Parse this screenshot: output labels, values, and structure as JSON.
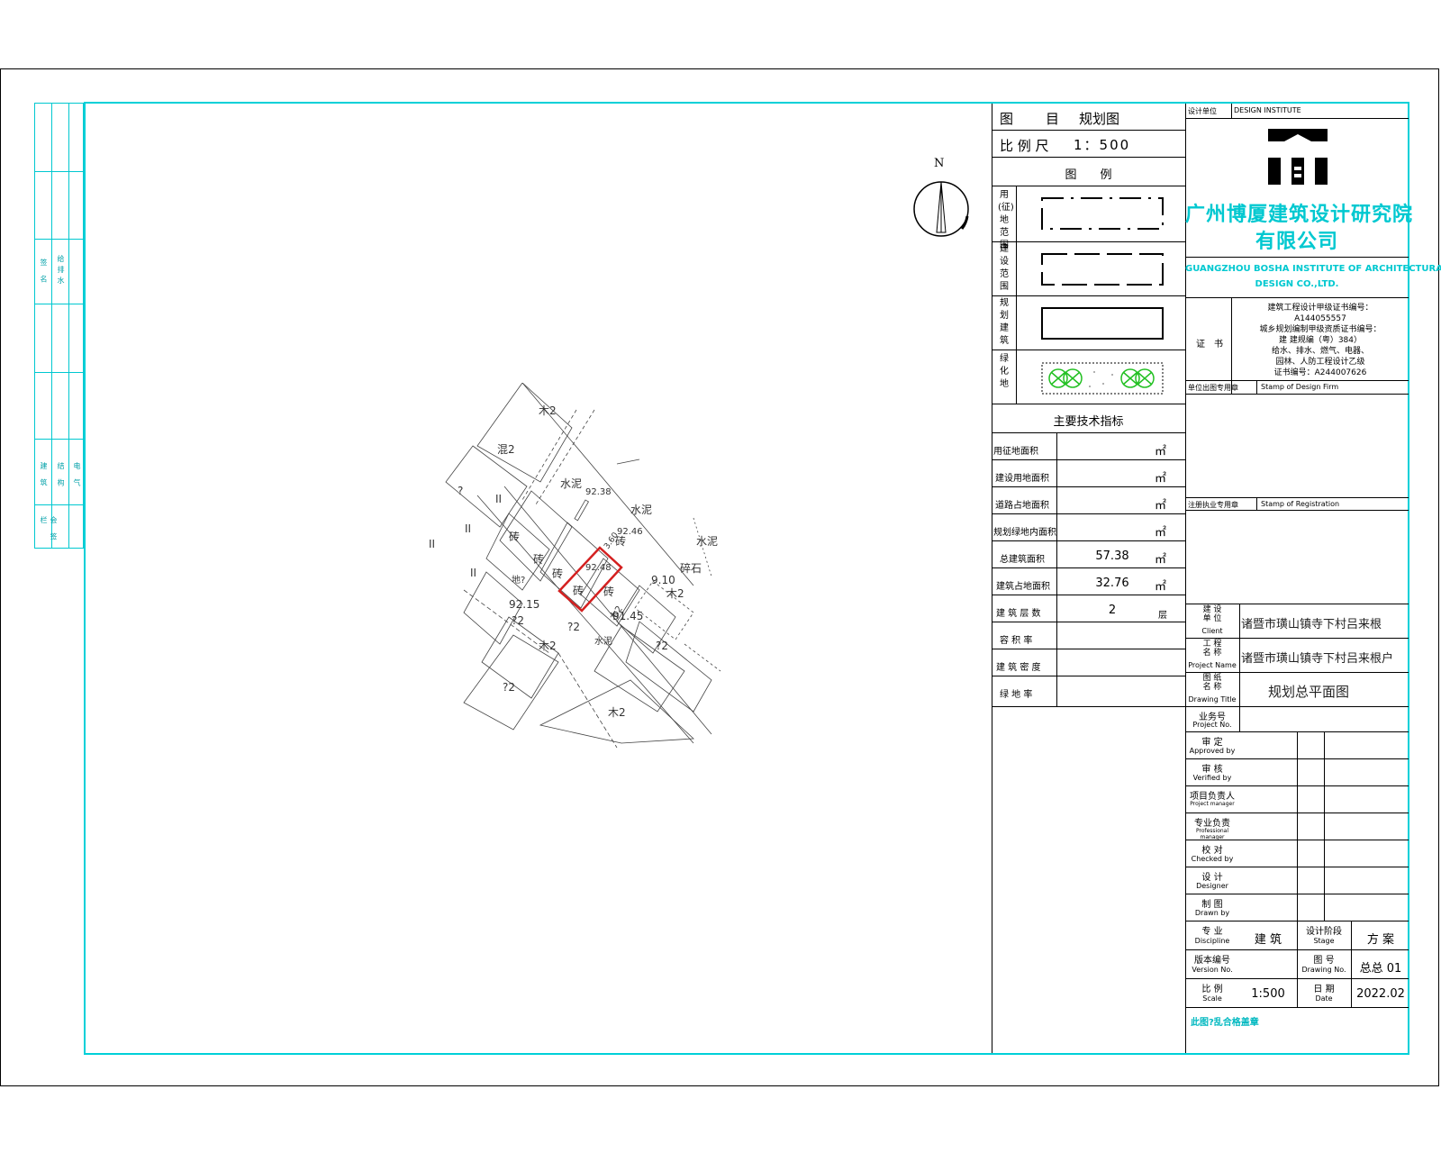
{
  "left_strip": {
    "labels": [
      "签 名",
      "给排水",
      "建 筑",
      "结 构",
      "电 气",
      "会 签 栏"
    ]
  },
  "north_arrow": {
    "letter": "N"
  },
  "site_plan": {
    "labels": [
      {
        "t": "木2"
      },
      {
        "t": "混2"
      },
      {
        "t": "水泥"
      },
      {
        "t": "92.38"
      },
      {
        "t": "水泥"
      },
      {
        "t": "92.46"
      },
      {
        "t": "砖"
      },
      {
        "t": "砖"
      },
      {
        "t": "砖"
      },
      {
        "t": "砖"
      },
      {
        "t": "砖"
      },
      {
        "t": "92.48"
      },
      {
        "t": "3.60"
      },
      {
        "t": "砖"
      },
      {
        "t": "木2"
      },
      {
        "t": "9.10"
      },
      {
        "t": "碎石"
      },
      {
        "t": "水泥"
      },
      {
        "t": "地?"
      },
      {
        "t": "92.15"
      },
      {
        "t": "?2"
      },
      {
        "t": "?2"
      },
      {
        "t": "水泥"
      },
      {
        "t": "91.45"
      },
      {
        "t": "木2"
      },
      {
        "t": "?2"
      },
      {
        "t": "?2"
      },
      {
        "t": "木2"
      },
      {
        "t": "木2"
      },
      {
        "t": "?"
      },
      {
        "t": "II"
      },
      {
        "t": "II"
      },
      {
        "t": "II"
      },
      {
        "t": "II"
      },
      {
        "t": "II"
      }
    ],
    "target_building_color": "#d42020"
  },
  "title_block": {
    "drawing_label": "图　　目",
    "drawing_name": "规划图",
    "scale_label": "比 例 尺",
    "scale_value": "1：500",
    "legend_title": "图　　例",
    "legend": [
      {
        "label": "用(征)地范围",
        "icon": "dash-dot-rect"
      },
      {
        "label": "建设范围",
        "icon": "dash-rect"
      },
      {
        "label": "规划建筑",
        "icon": "solid-rect"
      },
      {
        "label": "绿化地",
        "icon": "green-hatch"
      }
    ],
    "indicators_title": "主要技术指标",
    "indicators": [
      {
        "label": "用征地面积",
        "value": "",
        "unit": "㎡"
      },
      {
        "label": "建设用地面积",
        "value": "",
        "unit": "㎡"
      },
      {
        "label": "道路占地面积",
        "value": "",
        "unit": "㎡"
      },
      {
        "label": "规划绿地内面积",
        "value": "",
        "unit": "㎡"
      },
      {
        "label": "总建筑面积",
        "value": "57.38",
        "unit": "㎡"
      },
      {
        "label": "建筑占地面积",
        "value": "32.76",
        "unit": "㎡"
      },
      {
        "label": "建 筑 层 数",
        "value": "2",
        "unit": "层"
      },
      {
        "label": "容 积 率",
        "value": "",
        "unit": ""
      },
      {
        "label": "建 筑 密 度",
        "value": "",
        "unit": ""
      },
      {
        "label": "绿 地 率",
        "value": "",
        "unit": ""
      }
    ]
  },
  "company": {
    "unit_label": "设计单位",
    "unit_label_en": "DESIGN INSTITUTE",
    "name_cn_1": "广州博厦建筑设计研究院",
    "name_cn_2": "有限公司",
    "name_en_1": "GUANGZHOU BOSHA INSTITUTE OF ARCHITECTURAL",
    "name_en_2": "DESIGN CO.,LTD.",
    "cert_label": "证　书",
    "cert_lines": [
      "建筑工程设计甲级证书编号：",
      "A144055557",
      "城乡规划编制甲级资质证书编号：",
      "建 建规编（粤）384）",
      "给水、排水、燃气、电器、",
      "园林、人防工程设计乙级",
      "证书编号：A244007626"
    ],
    "stamp_label": "单位出图专用章",
    "stamp_label_en": "Stamp of Design Firm",
    "reg_label": "注册执业专用章",
    "reg_label_en": "Stamp of Registration",
    "brand_color": "#00c8d0"
  },
  "project_info": [
    {
      "label": "建 设\n单 位",
      "en": "Client",
      "value": "诸暨市璜山镇寺下村吕来根"
    },
    {
      "label": "工 程\n名 称",
      "en": "Project Name",
      "value": "诸暨市璜山镇寺下村吕来根户"
    },
    {
      "label": "图 纸\n名 称",
      "en": "Drawing Title",
      "value": "规划总平面图"
    },
    {
      "label": "业务号",
      "en": "Project No.",
      "value": ""
    }
  ],
  "signoffs": [
    {
      "label": "审 定",
      "en": "Approved by"
    },
    {
      "label": "审 核",
      "en": "Verified by"
    },
    {
      "label": "项目负责人",
      "en": "Project manager"
    },
    {
      "label": "专业负责",
      "en": "Professional manager"
    },
    {
      "label": "校 对",
      "en": "Checked by"
    },
    {
      "label": "设 计",
      "en": "Designer"
    },
    {
      "label": "制 图",
      "en": "Drawn by"
    }
  ],
  "bottom_rows": [
    {
      "l1": "专 业",
      "e1": "Discipline",
      "v1": "建 筑",
      "l2": "设计阶段",
      "e2": "Stage",
      "v2": "方 案"
    },
    {
      "l1": "版本编号",
      "e1": "Version No.",
      "v1": "",
      "l2": "图 号",
      "e2": "Drawing No.",
      "v2": "总总 01"
    },
    {
      "l1": "比 例",
      "e1": "Scale",
      "v1": "1:500",
      "l2": "日 期",
      "e2": "Date",
      "v2": "2022.02"
    }
  ],
  "footer_note": "此图?乱合格盖章"
}
